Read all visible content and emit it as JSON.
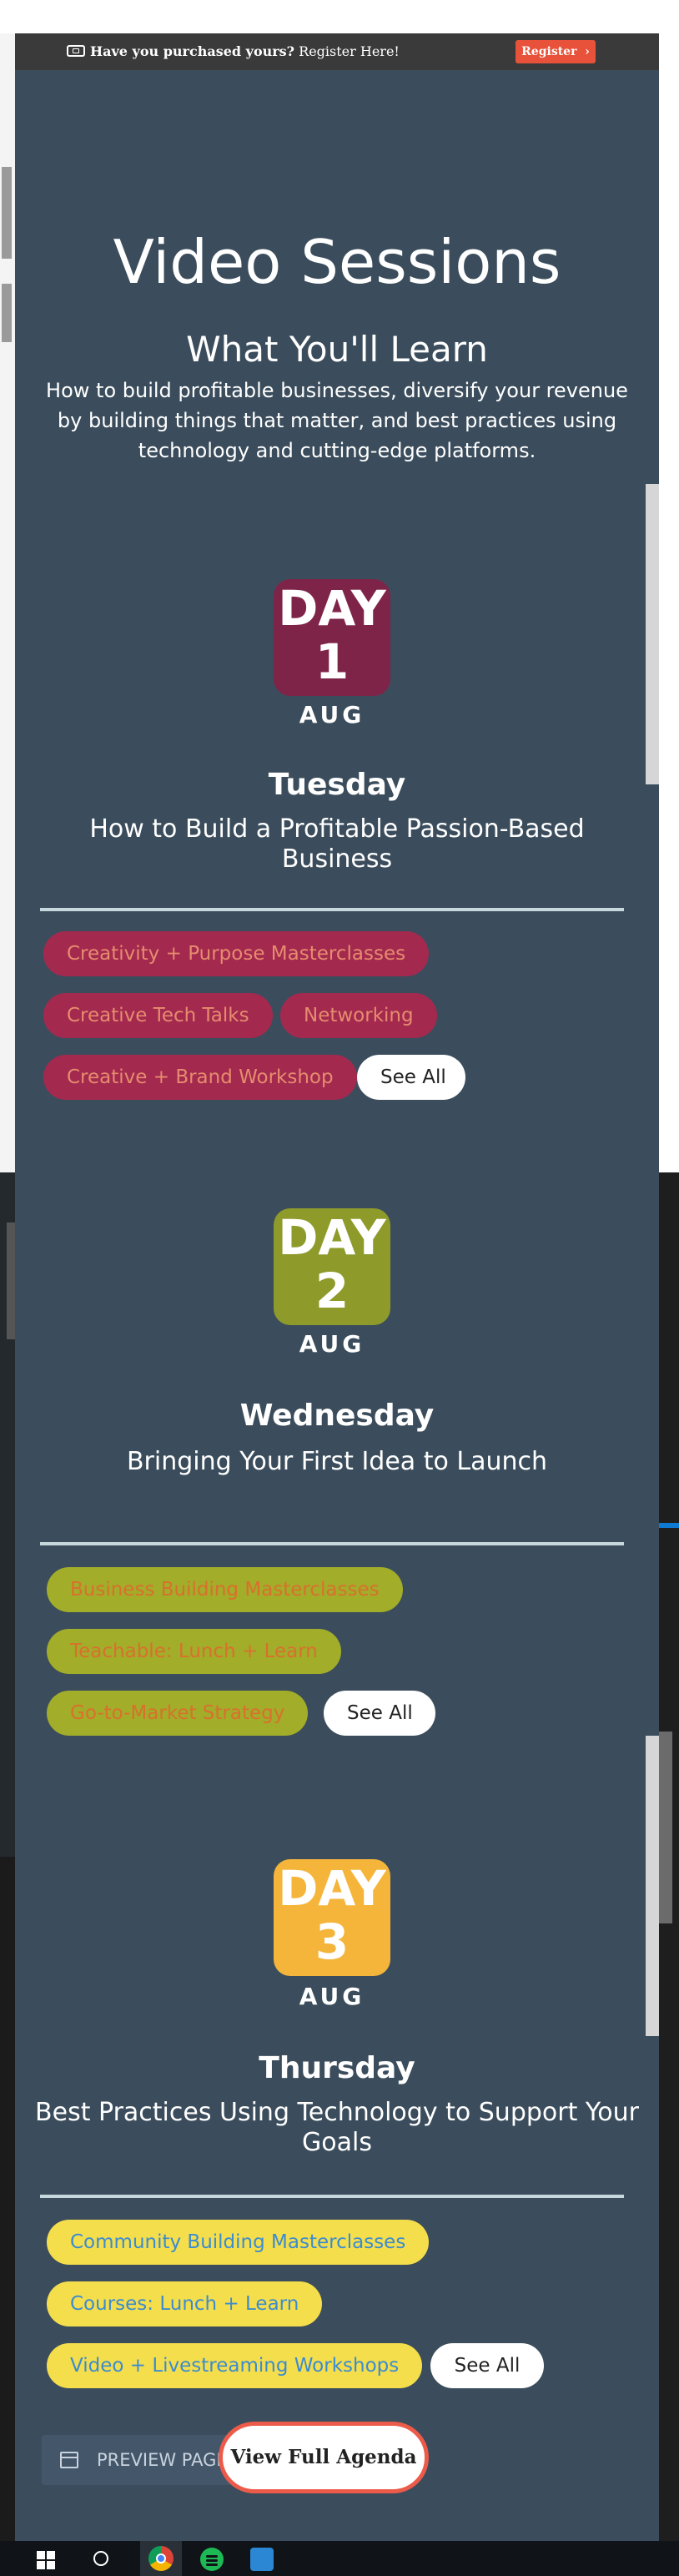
{
  "banner": {
    "promo_bold": "Have you purchased yours?",
    "promo_rest": " Register Here!",
    "register_label": "Register",
    "register_arrow": "›"
  },
  "header": {
    "title": "Video Sessions",
    "subtitle": "What You'll Learn",
    "intro": "How to build profitable businesses, diversify your revenue by building things that matter, and best practices using technology and cutting-edge platforms."
  },
  "days": [
    {
      "label": "DAY",
      "number": "1",
      "month": "AUG",
      "weekday": "Tuesday",
      "tagline": "How to Build a Profitable Passion-Based Business",
      "badge_color": "#7e2448",
      "pill_bg": "#a3294f",
      "pill_text": "#e58c6e",
      "tags": [
        "Creativity + Purpose Masterclasses",
        "Creative Tech Talks",
        "Networking",
        "Creative + Brand Workshop"
      ],
      "see_all": "See All"
    },
    {
      "label": "DAY",
      "number": "2",
      "month": "AUG",
      "weekday": "Wednesday",
      "tagline": "Bringing Your First Idea to Launch",
      "badge_color": "#8e9a2a",
      "pill_bg": "#a2ad29",
      "pill_text": "#d9702e",
      "tags": [
        "Business Building Masterclasses",
        "Teachable: Lunch + Learn",
        "Go-to-Market Strategy"
      ],
      "see_all": "See All"
    },
    {
      "label": "DAY",
      "number": "3",
      "month": "AUG",
      "weekday": "Thursday",
      "tagline": "Best Practices Using Technology to Support Your Goals",
      "badge_color": "#f4b53a",
      "pill_bg": "#f5de4c",
      "pill_text": "#3c8ccf",
      "tags": [
        "Community Building Masterclasses",
        "Courses: Lunch + Learn",
        "Video + Livestreaming Workshops"
      ],
      "see_all": "See All"
    }
  ],
  "footer": {
    "preview_label": "PREVIEW PAGE",
    "agenda_label": "View Full Agenda"
  },
  "taskbar": {
    "icons": [
      "windows-start-icon",
      "search-icon",
      "chrome-icon",
      "spotify-icon",
      "app-icon"
    ]
  }
}
